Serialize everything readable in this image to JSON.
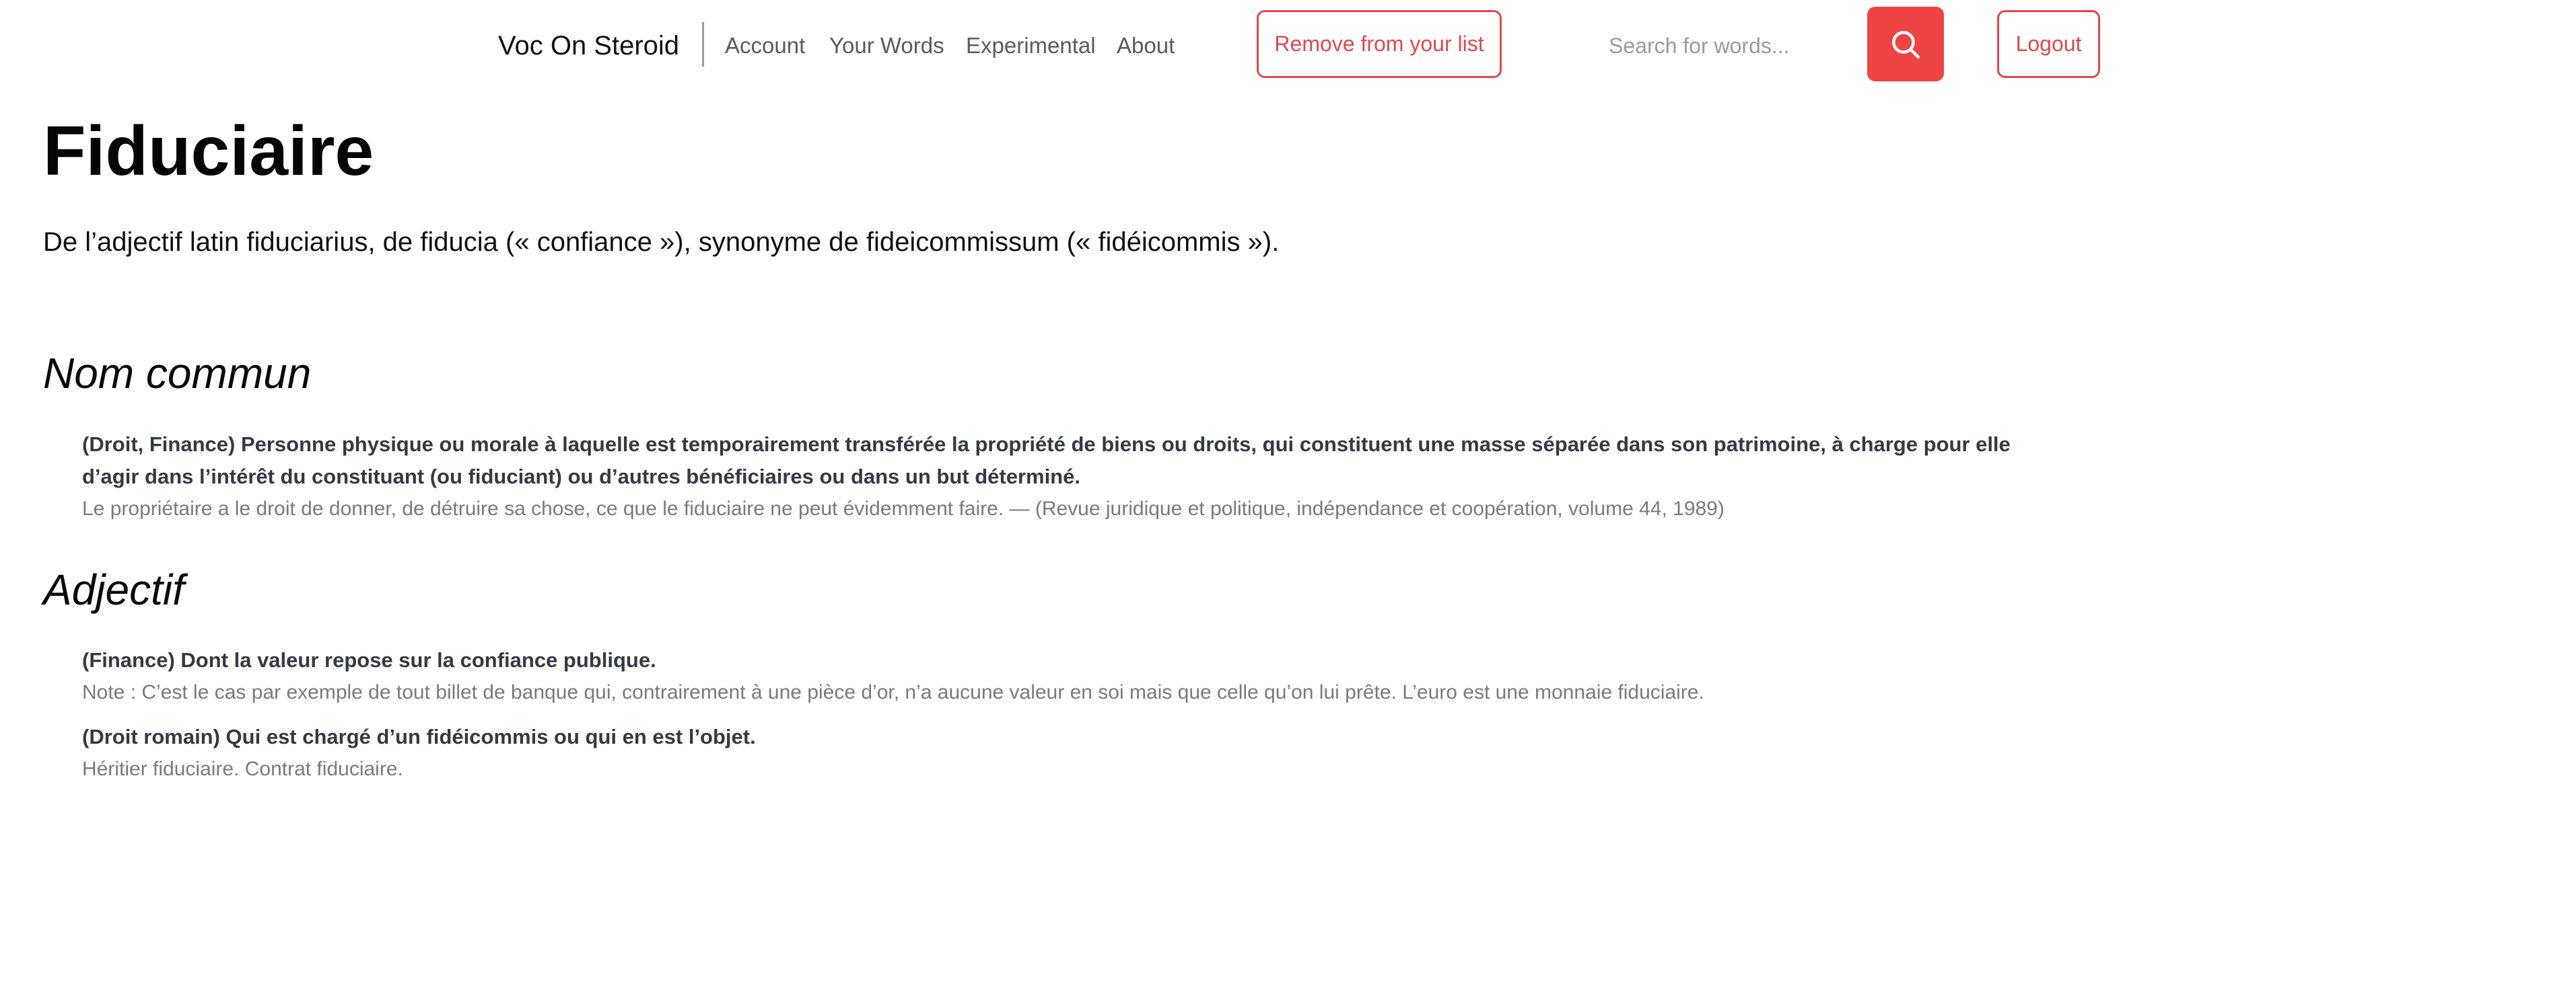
{
  "navbar": {
    "brand": "Voc On Steroid",
    "links": {
      "account": "Account",
      "your_words": "Your Words",
      "experimental": "Experimental",
      "about": "About"
    },
    "remove_button": "Remove from your list",
    "search": {
      "placeholder": "Search for words...",
      "value": "",
      "button_icon": "search-icon"
    },
    "logout_button": "Logout"
  },
  "colors": {
    "accent": "#ef4444",
    "accent_outline": "#e0484f"
  },
  "entry": {
    "word": "Fiduciaire",
    "etymology": "De l’adjectif latin fiduciarius, de fiducia (« confiance »), synonyme de fideicommissum (« fidéicommis »).",
    "sections": [
      {
        "pos": "Nom commun",
        "definitions": [
          {
            "text": "(Droit, Finance) Personne physique ou morale à laquelle est temporairement transférée la propriété de biens ou droits, qui constituent une masse séparée dans son patrimoine, à charge pour elle d’agir dans l’intérêt du constituant (ou fiduciant) ou d’autres bénéficiaires ou dans un but déterminé.",
            "example": "Le propriétaire a le droit de donner, de détruire sa chose, ce que le fiduciaire ne peut évidemment faire. — (Revue juridique et politique, indépendance et coopération, volume 44, 1989)"
          }
        ]
      },
      {
        "pos": "Adjectif",
        "definitions": [
          {
            "text": "(Finance) Dont la valeur repose sur la confiance publique.",
            "example": "Note : C’est le cas par exemple de tout billet de banque qui, contrairement à une pièce d’or, n’a aucune valeur en soi mais que celle qu’on lui prête. L’euro est une monnaie fiduciaire."
          },
          {
            "text": "(Droit romain) Qui est chargé d’un fidéicommis ou qui en est l’objet.",
            "example": "Héritier fiduciaire. Contrat fiduciaire."
          }
        ]
      }
    ]
  }
}
